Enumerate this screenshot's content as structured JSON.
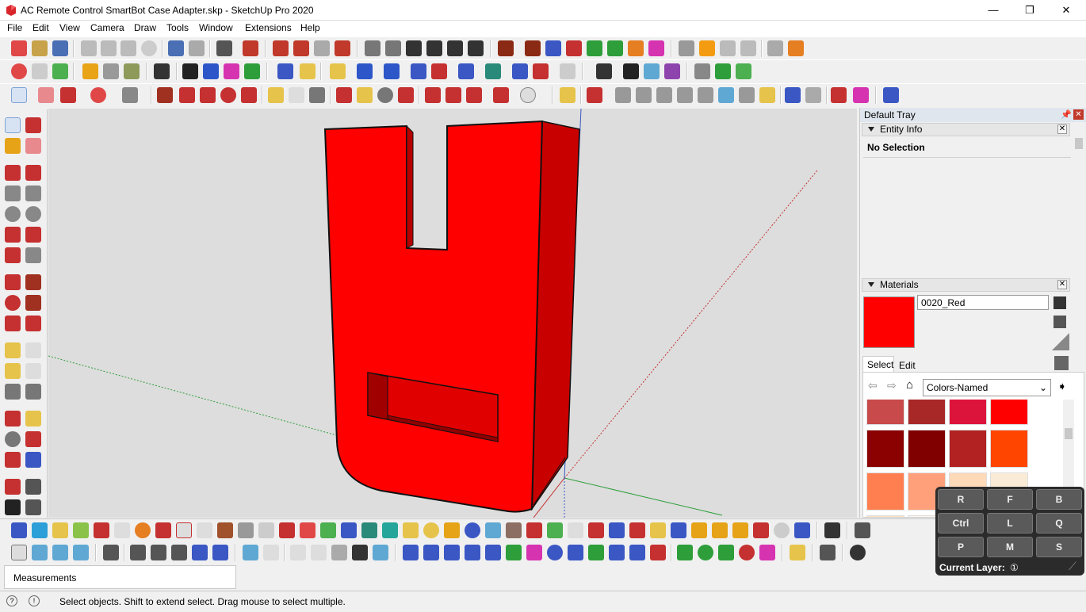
{
  "window": {
    "title": "AC Remote Control SmartBot Case Adapter.skp - SketchUp Pro 2020",
    "minimize": "—",
    "maximize": "❐",
    "close": "✕"
  },
  "menu": [
    "File",
    "Edit",
    "View",
    "Camera",
    "Draw",
    "Tools",
    "Window",
    "Extensions",
    "Help"
  ],
  "tray": {
    "title": "Default Tray",
    "entity_info": {
      "header": "Entity Info",
      "text": "No Selection"
    },
    "materials": {
      "header": "Materials",
      "current_name": "0020_Red",
      "current_color": "#ff0000",
      "tab_select": "Select",
      "tab_edit": "Edit",
      "library": "Colors-Named",
      "swatches": [
        "#c84a4a",
        "#a82828",
        "#dc143c",
        "#ff0000",
        "#8b0000",
        "#800000",
        "#b22222",
        "#ff4500",
        "#ff7f50",
        "#ffa07a",
        "#ffdab9",
        "#faebd7",
        "#ffe4c4",
        "#fff5ee"
      ]
    }
  },
  "keyboard_overlay": {
    "keys": [
      "R",
      "F",
      "B",
      "Ctrl",
      "L",
      "Q",
      "P",
      "M",
      "S"
    ],
    "current_layer_label": "Current Layer:",
    "current_layer_value": "①"
  },
  "measurements_label": "Measurements",
  "status_text": "Select objects. Shift to extend select. Drag mouse to select multiple.",
  "model_color": "#ff0000"
}
